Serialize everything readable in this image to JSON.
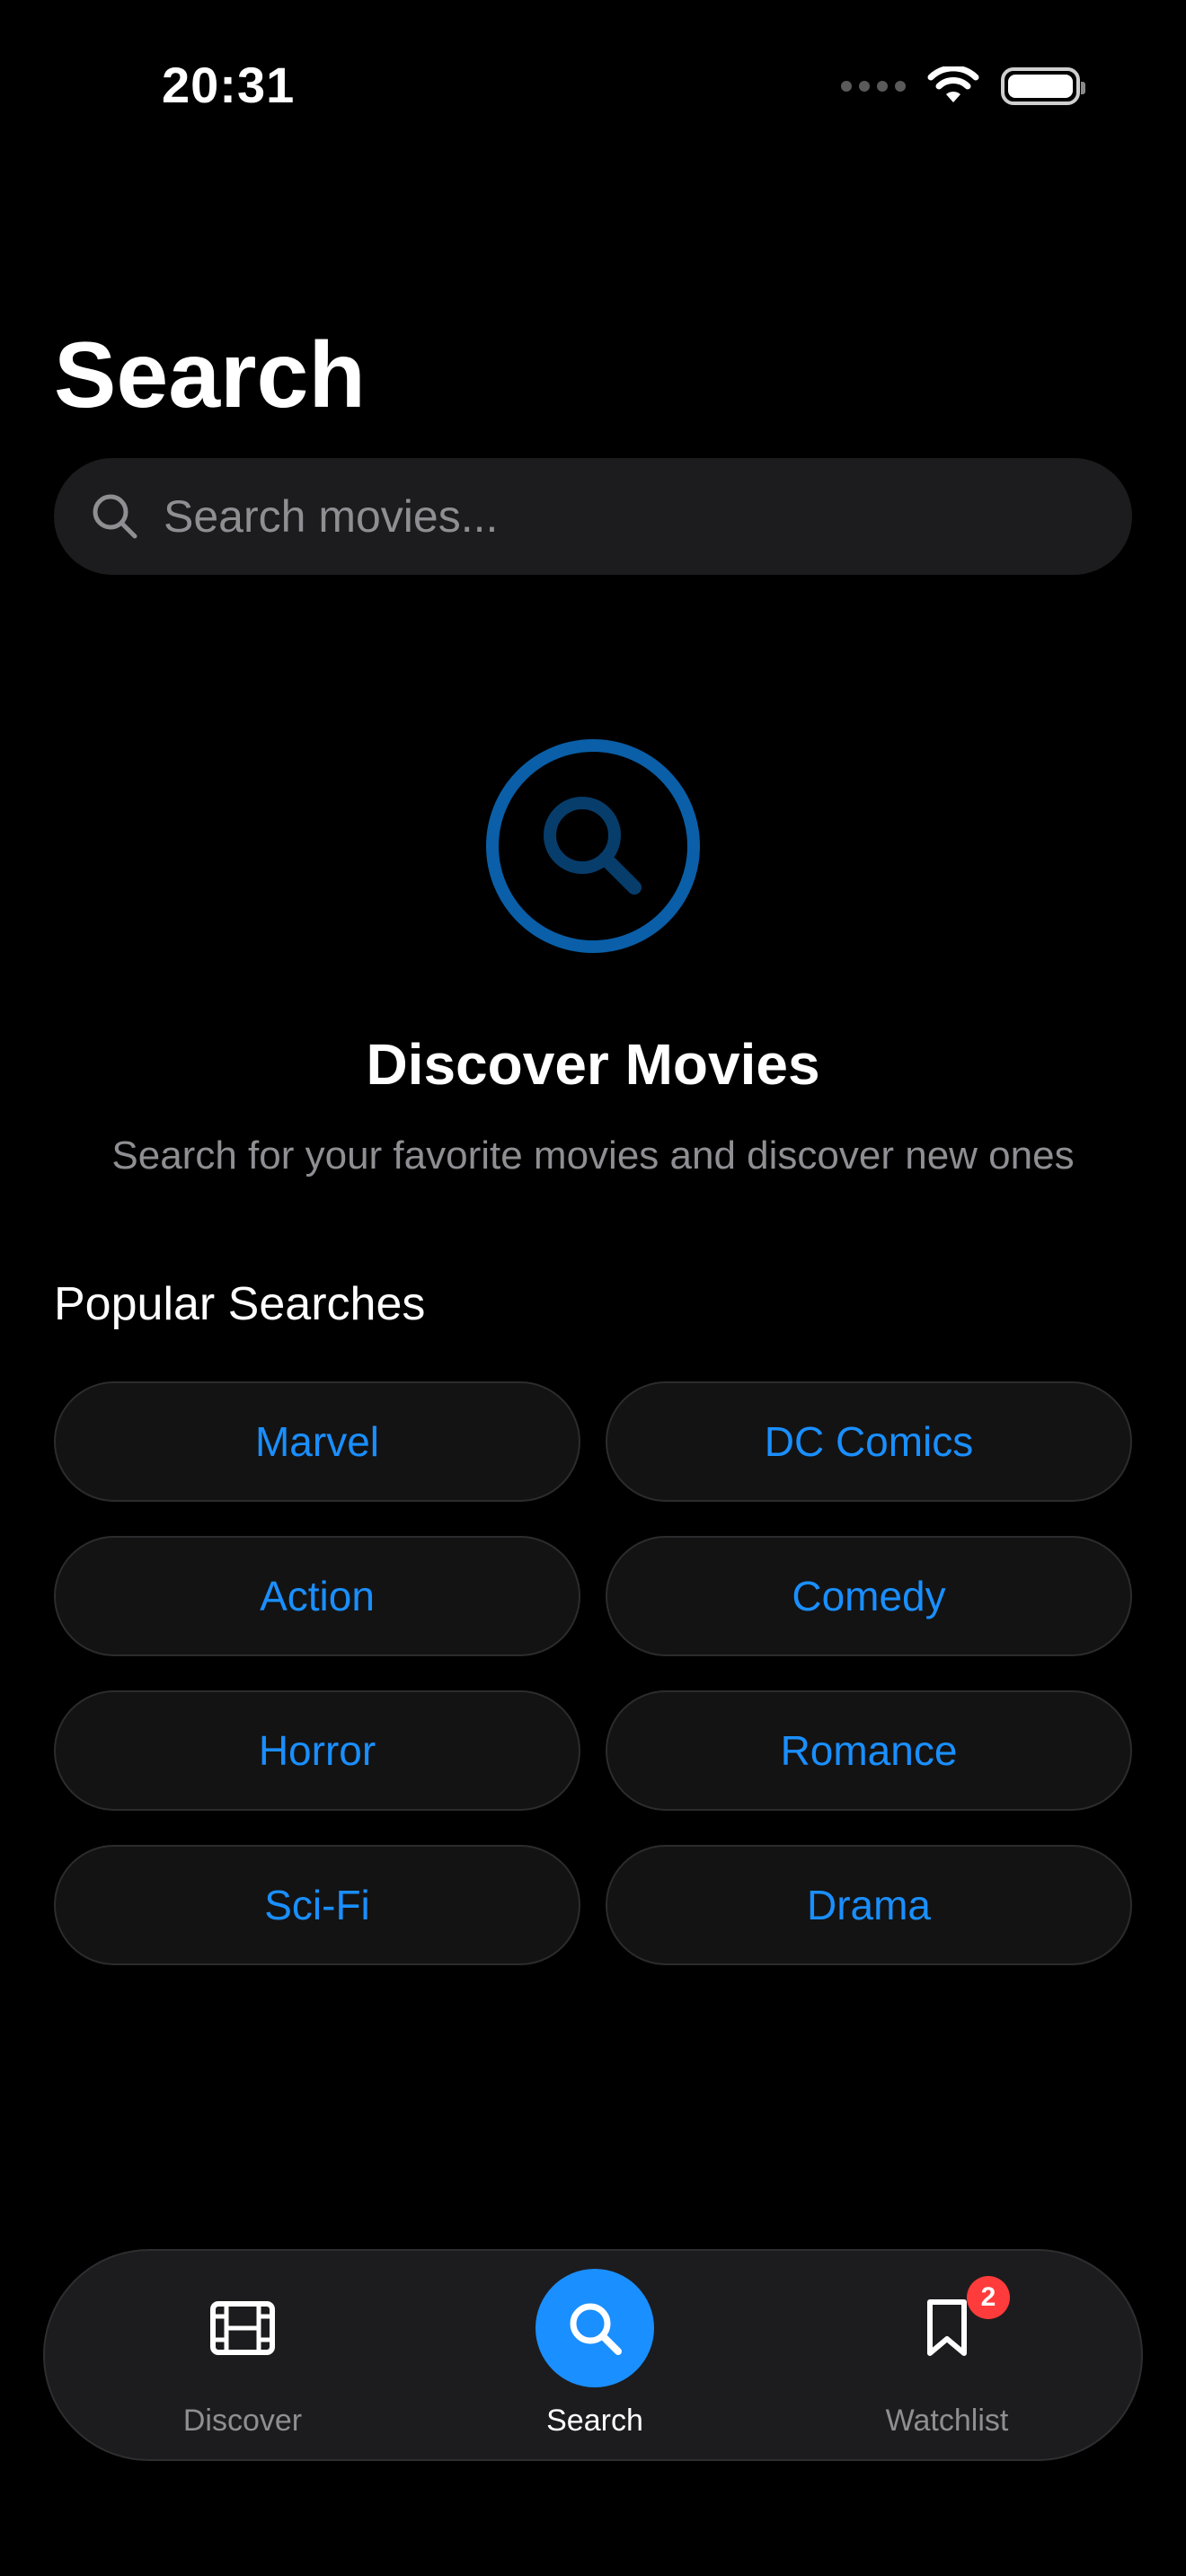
{
  "status_bar": {
    "time": "20:31"
  },
  "header": {
    "title": "Search"
  },
  "search": {
    "placeholder": "Search movies...",
    "value": ""
  },
  "empty_state": {
    "title": "Discover Movies",
    "subtitle": "Search for your favorite movies and discover new ones",
    "icon": "magnifying-glass-circle-icon"
  },
  "popular": {
    "title": "Popular Searches",
    "items": [
      {
        "label": "Marvel"
      },
      {
        "label": "DC Comics"
      },
      {
        "label": "Action"
      },
      {
        "label": "Comedy"
      },
      {
        "label": "Horror"
      },
      {
        "label": "Romance"
      },
      {
        "label": "Sci-Fi"
      },
      {
        "label": "Drama"
      }
    ]
  },
  "tab_bar": {
    "tabs": [
      {
        "label": "Discover",
        "icon": "film-icon",
        "active": false
      },
      {
        "label": "Search",
        "icon": "search-icon",
        "active": true
      },
      {
        "label": "Watchlist",
        "icon": "bookmark-icon",
        "active": false,
        "badge": "2"
      }
    ]
  },
  "colors": {
    "accent": "#1a8fff",
    "background": "#000000",
    "surface": "#1c1c1e",
    "secondary_text": "#8e8e93",
    "badge": "#ff3b3b"
  }
}
